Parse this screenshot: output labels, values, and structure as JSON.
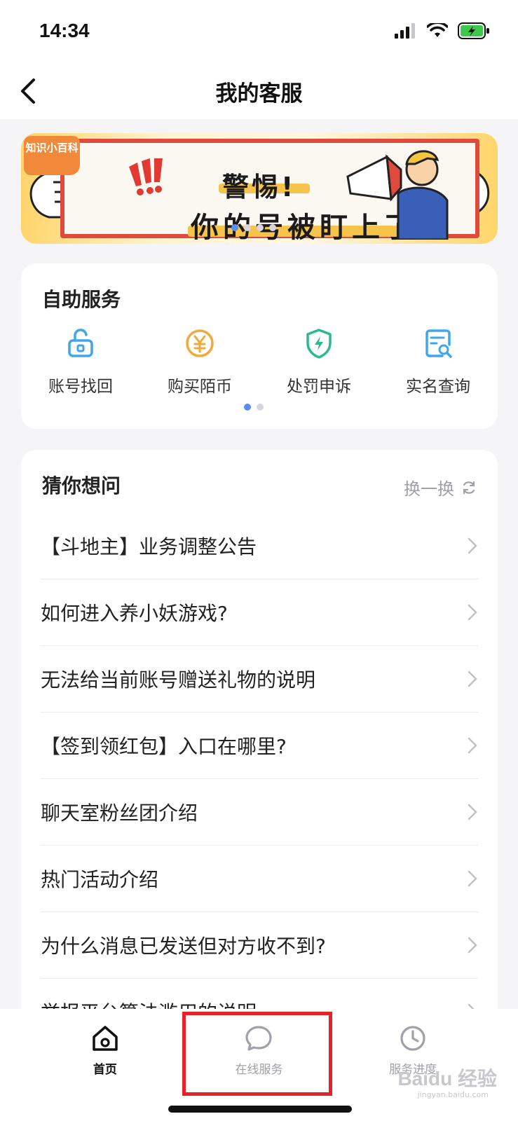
{
  "status": {
    "time": "14:34"
  },
  "nav": {
    "title": "我的客服"
  },
  "banner": {
    "tag": "知识小百科",
    "headline_1": "警惕!",
    "headline_2": "你的号被盯上了",
    "dots": 4,
    "active_dot": 0
  },
  "self_service": {
    "title": "自助服务",
    "items": [
      {
        "label": "账号找回",
        "icon": "unlock-icon",
        "color": "#3fa6ee"
      },
      {
        "label": "购买陌币",
        "icon": "coin-icon",
        "color": "#f2a93b"
      },
      {
        "label": "处罚申诉",
        "icon": "shield-icon",
        "color": "#2bb98f"
      },
      {
        "label": "实名查询",
        "icon": "document-search-icon",
        "color": "#3fa6ee"
      }
    ]
  },
  "guess": {
    "title": "猜你想问",
    "refresh_label": "换一换",
    "questions": [
      "【斗地主】业务调整公告",
      "如何进入养小妖游戏?",
      "无法给当前账号赠送礼物的说明",
      "【签到领红包】入口在哪里?",
      "聊天室粉丝团介绍",
      "热门活动介绍",
      "为什么消息已发送但对方收不到?",
      "举报平台算法滥用的说明"
    ]
  },
  "tabs": [
    {
      "label": "首页",
      "icon": "home-icon",
      "active": true
    },
    {
      "label": "在线服务",
      "icon": "chat-icon",
      "active": false
    },
    {
      "label": "服务进度",
      "icon": "clock-icon",
      "active": false
    }
  ],
  "watermark": {
    "main": "Baidu 经验",
    "sub": "jingyan.baidu.com"
  }
}
